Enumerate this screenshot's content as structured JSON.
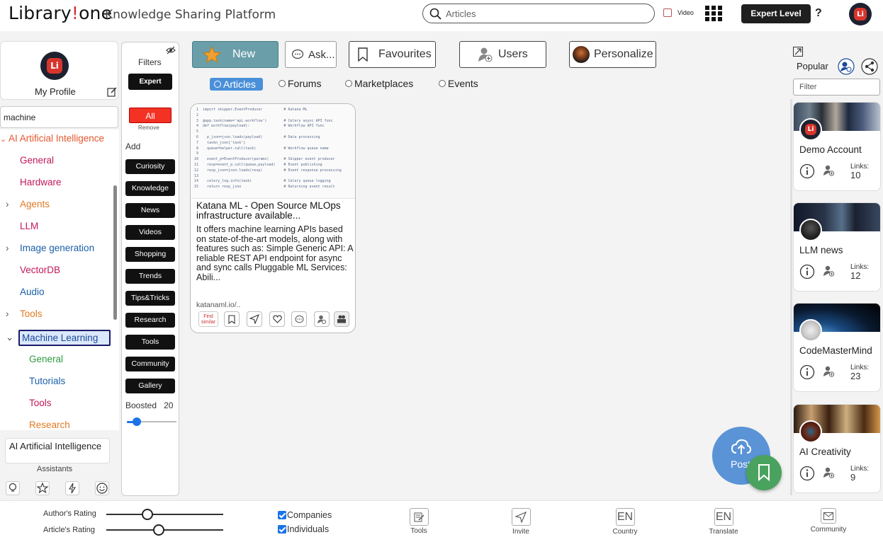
{
  "header": {
    "logo_part1": "Library",
    "logo_part2": "!",
    "logo_part3": "one",
    "subtitle": "Knowledge Sharing Platform",
    "search_placeholder": "Articles",
    "video_label": "Video",
    "video_checked": false,
    "expert_level_label": "Expert Level",
    "help_label": "?",
    "avatar_text": "Li"
  },
  "profile": {
    "label": "My Profile",
    "avatar_text": "Li"
  },
  "left_search": {
    "value": "machine"
  },
  "tree": {
    "items": [
      {
        "label": "AI Artificial Intelligence",
        "color": "#e4572e",
        "chevron": "down"
      },
      {
        "label": "General",
        "color": "#c2185b"
      },
      {
        "label": "Hardware",
        "color": "#c2185b"
      },
      {
        "label": "Agents",
        "color": "#e07a22",
        "chevron": "right"
      },
      {
        "label": "LLM",
        "color": "#c2185b"
      },
      {
        "label": "Image generation",
        "color": "#1a5fa8",
        "chevron": "right"
      },
      {
        "label": "VectorDB",
        "color": "#c2185b"
      },
      {
        "label": "Audio",
        "color": "#1a5fa8"
      },
      {
        "label": "Tools",
        "color": "#e07a22",
        "chevron": "right"
      },
      {
        "label": "Machine Learning",
        "color": "#1a4a9a",
        "chevron": "down"
      },
      {
        "label": "General",
        "color": "#2e9a3e"
      },
      {
        "label": "Tutorials",
        "color": "#1a5fa8"
      },
      {
        "label": "Tools",
        "color": "#c2185b"
      },
      {
        "label": "Research",
        "color": "#e07a22"
      }
    ]
  },
  "assistants": {
    "selected": "AI Artificial Intelligence",
    "label": "Assistants"
  },
  "filters": {
    "title": "Filters",
    "expert": "Expert",
    "all": "All",
    "remove": "Remove",
    "add": "Add",
    "tags": [
      "Curiosity",
      "Knowledge",
      "News",
      "Videos",
      "Shopping",
      "Trends",
      "Tips&Tricks",
      "Research",
      "Tools",
      "Community",
      "Gallery"
    ],
    "boosted_label": "Boosted",
    "boosted_value": "20",
    "boosted_level": 0.2
  },
  "tabs": {
    "new": "New",
    "ask": "Ask...",
    "favourites": "Favourites",
    "users": "Users",
    "personalize": "Personalize"
  },
  "content_types": {
    "selected": "Articles",
    "options": [
      "Forums",
      "Marketplaces",
      "Events"
    ]
  },
  "article": {
    "title": "Katana ML - Open Source MLOps infrastructure available...",
    "description": "It offers machine learning APIs based on state-of-the-art models, along with features such as: Simple Generic API: A reliable REST API endpoint for async and sync calls Pluggable ML Services: Abili...",
    "url": "katanaml.io/..",
    "find_similar": "Find similar",
    "code_lines": [
      "import skipper.EventProducer          # Katana ML",
      "",
      "@app.task(name='api.workflow')        # Celery async API func",
      "def workflow(payload):                # Workflow API func",
      "",
      "  p_json=json.loads(payload)          # Data processing",
      "  taskn_json['task']",
      "  queue=helper.call(task)             # Workflow queue name",
      "",
      "  event_p=EventProducer(params)       # Skipper event producer",
      "  resp=event_p.call(queue,payload)    # Event publishing",
      "  resp_json=json.loads(resp)          # Event response processing",
      "",
      "  celery_log.info(task)               # Celery queue logging",
      "  return resp_json                    # Returning event result"
    ]
  },
  "right": {
    "popular_label": "Popular",
    "filter_placeholder": "Filter",
    "links_label": "Links:",
    "users": [
      {
        "name": "Demo Account",
        "links": "10"
      },
      {
        "name": "LLM news",
        "links": "12"
      },
      {
        "name": "CodeMasterMind",
        "links": "23"
      },
      {
        "name": "AI Creativity",
        "links": "9"
      }
    ]
  },
  "post_label": "Post",
  "footer": {
    "author_rating": "Author's Rating",
    "article_rating": "Article's Rating",
    "author_rating_level": 0.35,
    "article_rating_level": 0.45,
    "companies": "Companies",
    "individuals": "Individuals",
    "tools": "Tools",
    "invite": "Invite",
    "country_code": "EN",
    "country": "Country",
    "translate_code": "EN",
    "translate": "Translate",
    "community": "Community"
  }
}
